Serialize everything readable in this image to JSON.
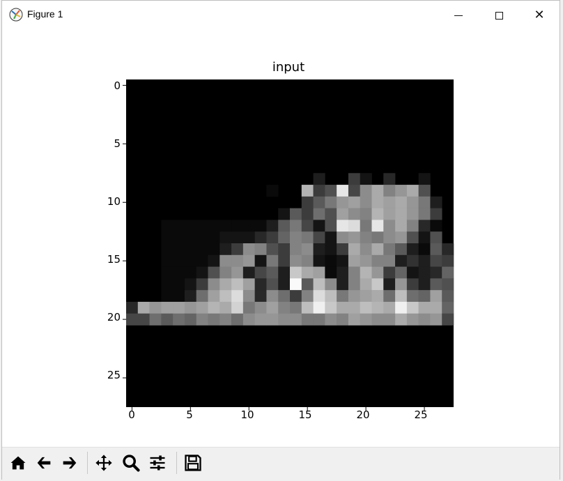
{
  "window": {
    "title": "Figure 1",
    "minimize_icon": "minimize-icon",
    "maximize_icon": "maximize-icon",
    "close_label": "✕"
  },
  "plot": {
    "title": "input",
    "colormap": "gray",
    "y_ticks": [
      "0",
      "5",
      "10",
      "15",
      "20",
      "25"
    ],
    "x_ticks": [
      "0",
      "5",
      "10",
      "15",
      "20",
      "25"
    ],
    "grid_size": 28
  },
  "chart_data": {
    "type": "heatmap",
    "title": "input",
    "colormap": "gray",
    "x_range": [
      0,
      27
    ],
    "y_range": [
      0,
      27
    ],
    "y_axis_inverted": true,
    "nonzero_rows_start": 8,
    "rows": {
      "8": [
        0,
        0,
        0,
        0,
        0,
        0,
        0,
        0,
        0,
        0,
        0,
        0,
        0,
        0,
        0,
        0,
        30,
        0,
        0,
        60,
        20,
        0,
        40,
        0,
        0,
        20,
        0,
        0
      ],
      "9": [
        0,
        0,
        0,
        0,
        0,
        0,
        0,
        0,
        0,
        0,
        0,
        0,
        10,
        0,
        0,
        180,
        60,
        80,
        230,
        70,
        140,
        170,
        130,
        150,
        170,
        80,
        0,
        0
      ],
      "10": [
        0,
        0,
        0,
        0,
        0,
        0,
        0,
        0,
        0,
        0,
        0,
        0,
        0,
        0,
        0,
        60,
        90,
        120,
        150,
        160,
        140,
        170,
        160,
        170,
        150,
        120,
        30,
        0
      ],
      "11": [
        0,
        0,
        0,
        0,
        0,
        0,
        0,
        0,
        0,
        0,
        0,
        0,
        0,
        20,
        90,
        60,
        110,
        80,
        160,
        140,
        130,
        180,
        160,
        170,
        150,
        120,
        60,
        0
      ],
      "12": [
        0,
        0,
        0,
        10,
        10,
        10,
        10,
        10,
        10,
        10,
        10,
        10,
        30,
        90,
        120,
        70,
        20,
        80,
        230,
        220,
        120,
        230,
        140,
        170,
        130,
        40,
        10,
        0
      ],
      "13": [
        0,
        0,
        0,
        10,
        10,
        10,
        10,
        10,
        20,
        20,
        20,
        40,
        60,
        100,
        130,
        120,
        70,
        20,
        140,
        150,
        130,
        120,
        140,
        150,
        80,
        20,
        80,
        0
      ],
      "14": [
        0,
        0,
        0,
        10,
        10,
        10,
        10,
        10,
        30,
        60,
        140,
        130,
        80,
        60,
        130,
        140,
        30,
        20,
        60,
        170,
        140,
        170,
        120,
        90,
        30,
        10,
        90,
        40
      ],
      "15": [
        0,
        0,
        0,
        10,
        10,
        10,
        10,
        20,
        140,
        140,
        150,
        20,
        120,
        60,
        140,
        130,
        20,
        10,
        20,
        160,
        150,
        130,
        130,
        30,
        50,
        30,
        70,
        60
      ],
      "16": [
        0,
        0,
        0,
        10,
        10,
        10,
        20,
        80,
        130,
        150,
        30,
        70,
        90,
        30,
        200,
        170,
        160,
        10,
        30,
        130,
        180,
        150,
        60,
        100,
        20,
        30,
        40,
        100
      ],
      "17": [
        0,
        0,
        0,
        10,
        10,
        20,
        60,
        140,
        170,
        190,
        160,
        40,
        80,
        30,
        250,
        90,
        190,
        140,
        30,
        130,
        170,
        200,
        30,
        150,
        60,
        30,
        90,
        80
      ],
      "18": [
        0,
        0,
        0,
        10,
        10,
        30,
        110,
        160,
        190,
        220,
        140,
        40,
        140,
        110,
        60,
        130,
        220,
        190,
        120,
        150,
        160,
        170,
        110,
        190,
        110,
        100,
        160,
        90
      ],
      "19": [
        40,
        170,
        150,
        160,
        160,
        150,
        160,
        180,
        170,
        210,
        120,
        140,
        160,
        130,
        120,
        190,
        240,
        200,
        170,
        170,
        190,
        180,
        170,
        240,
        200,
        170,
        170,
        100
      ],
      "20": [
        70,
        70,
        110,
        90,
        110,
        100,
        130,
        120,
        130,
        110,
        140,
        150,
        150,
        140,
        140,
        120,
        120,
        140,
        130,
        160,
        150,
        140,
        140,
        170,
        150,
        140,
        150,
        70
      ],
      "21": [
        0,
        0,
        0,
        0,
        0,
        0,
        0,
        0,
        0,
        0,
        0,
        0,
        0,
        0,
        0,
        0,
        0,
        0,
        0,
        0,
        0,
        0,
        0,
        0,
        0,
        0,
        0,
        0
      ]
    }
  },
  "toolbar": {
    "home": "home-icon",
    "back": "back-arrow-icon",
    "forward": "forward-arrow-icon",
    "pan": "pan-icon",
    "zoom": "zoom-icon",
    "configure": "configure-subplots-icon",
    "save": "save-icon"
  }
}
